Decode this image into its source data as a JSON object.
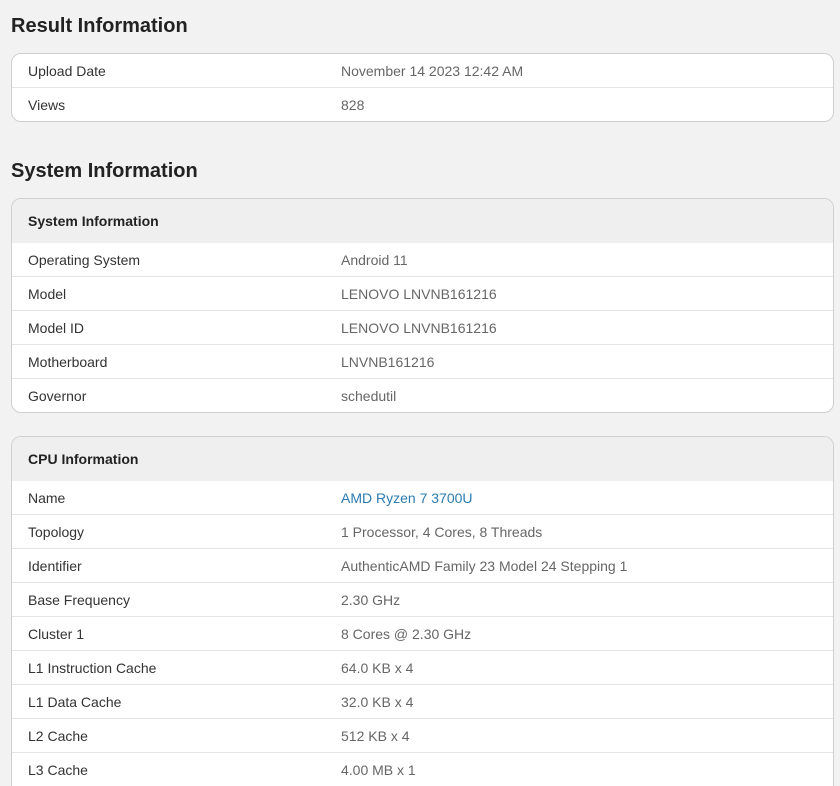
{
  "result": {
    "heading": "Result Information",
    "rows": [
      {
        "key": "Upload Date",
        "value": "November 14 2023 12:42 AM"
      },
      {
        "key": "Views",
        "value": "828"
      }
    ]
  },
  "system": {
    "heading": "System Information",
    "card_title": "System Information",
    "rows": [
      {
        "key": "Operating System",
        "value": "Android 11"
      },
      {
        "key": "Model",
        "value": "LENOVO LNVNB161216"
      },
      {
        "key": "Model ID",
        "value": "LENOVO LNVNB161216"
      },
      {
        "key": "Motherboard",
        "value": "LNVNB161216"
      },
      {
        "key": "Governor",
        "value": "schedutil"
      }
    ]
  },
  "cpu": {
    "card_title": "CPU Information",
    "link_color": "#2a7bb0",
    "rows": [
      {
        "key": "Name",
        "value": "AMD Ryzen 7 3700U"
      },
      {
        "key": "Topology",
        "value": "1 Processor, 4 Cores, 8 Threads"
      },
      {
        "key": "Identifier",
        "value": "AuthenticAMD Family 23 Model 24 Stepping 1"
      },
      {
        "key": "Base Frequency",
        "value": "2.30 GHz"
      },
      {
        "key": "Cluster 1",
        "value": "8 Cores @ 2.30 GHz"
      },
      {
        "key": "L1 Instruction Cache",
        "value": "64.0 KB x 4"
      },
      {
        "key": "L1 Data Cache",
        "value": "32.0 KB x 4"
      },
      {
        "key": "L2 Cache",
        "value": "512 KB x 4"
      },
      {
        "key": "L3 Cache",
        "value": "4.00 MB x 1"
      }
    ]
  }
}
